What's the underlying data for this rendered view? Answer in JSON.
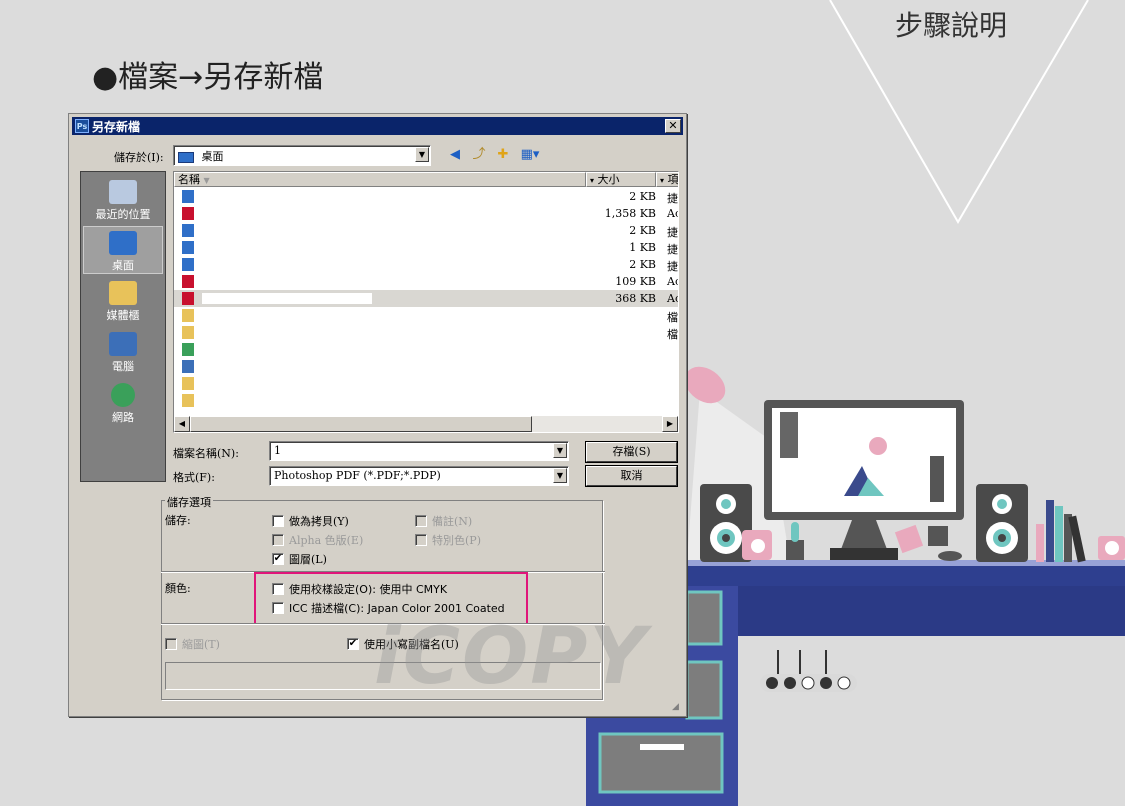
{
  "page": {
    "step_label": "步驟說明",
    "heading": "●檔案→另存新檔",
    "watermark": "iCOPY"
  },
  "dialog": {
    "title": "另存新檔",
    "title_icon": "Ps",
    "close_glyph": "✕",
    "save_in_label": "儲存於(I):",
    "save_in_value": "桌面",
    "places": [
      {
        "label": "最近的位置",
        "icon": "recent-places-icon"
      },
      {
        "label": "桌面",
        "icon": "desktop-icon"
      },
      {
        "label": "媒體櫃",
        "icon": "libraries-icon"
      },
      {
        "label": "電腦",
        "icon": "computer-icon"
      },
      {
        "label": "網路",
        "icon": "network-icon"
      }
    ],
    "columns": {
      "name": "名稱",
      "size": "大小",
      "type": "項"
    },
    "files": [
      {
        "icon": "shortcut",
        "size": "2 KB",
        "type": "捷"
      },
      {
        "icon": "pdf",
        "size": "1,358 KB",
        "type": "Ac"
      },
      {
        "icon": "shortcut",
        "size": "2 KB",
        "type": "捷"
      },
      {
        "icon": "shortcut",
        "size": "1 KB",
        "type": "捷"
      },
      {
        "icon": "shortcut",
        "size": "2 KB",
        "type": "捷"
      },
      {
        "icon": "pdf",
        "size": "109 KB",
        "type": "Ac"
      },
      {
        "icon": "pdf",
        "size": "368 KB",
        "type": "Ac"
      },
      {
        "icon": "folder",
        "size": "",
        "type": "檔"
      },
      {
        "icon": "folder",
        "size": "",
        "type": "檔"
      },
      {
        "icon": "network",
        "size": "",
        "type": ""
      },
      {
        "icon": "computer",
        "size": "",
        "type": ""
      },
      {
        "icon": "user-folder",
        "size": "",
        "type": ""
      },
      {
        "icon": "library",
        "size": "",
        "type": ""
      }
    ],
    "filename_label": "檔案名稱(N):",
    "filename_value": "1",
    "format_label": "格式(F):",
    "format_value": "Photoshop PDF (*.PDF;*.PDP)",
    "save_button": "存檔(S)",
    "cancel_button": "取消",
    "options_group_title": "儲存選項",
    "save_label": "儲存:",
    "color_label": "顏色:",
    "checkboxes": {
      "as_copy": {
        "label": "做為拷貝(Y)",
        "checked": false,
        "enabled": true
      },
      "notes": {
        "label": "備註(N)",
        "checked": false,
        "enabled": false
      },
      "alpha": {
        "label": "Alpha 色版(E)",
        "checked": false,
        "enabled": false
      },
      "spot": {
        "label": "特別色(P)",
        "checked": false,
        "enabled": false
      },
      "layers": {
        "label": "圖層(L)",
        "checked": true,
        "enabled": true
      },
      "proof": {
        "label": "使用校樣設定(O):  使用中 CMYK",
        "checked": false,
        "enabled": true
      },
      "icc": {
        "label": "ICC 描述檔(C):  Japan Color 2001 Coated",
        "checked": false,
        "enabled": true
      },
      "thumbnail": {
        "label": "縮圖(T)",
        "checked": false,
        "enabled": false
      },
      "lowercase": {
        "label": "使用小寫副檔名(U)",
        "checked": true,
        "enabled": true
      }
    }
  },
  "colors": {
    "highlight": "#e0157a",
    "titlebar": "#0a246a",
    "desk": "#2e3f8f"
  }
}
